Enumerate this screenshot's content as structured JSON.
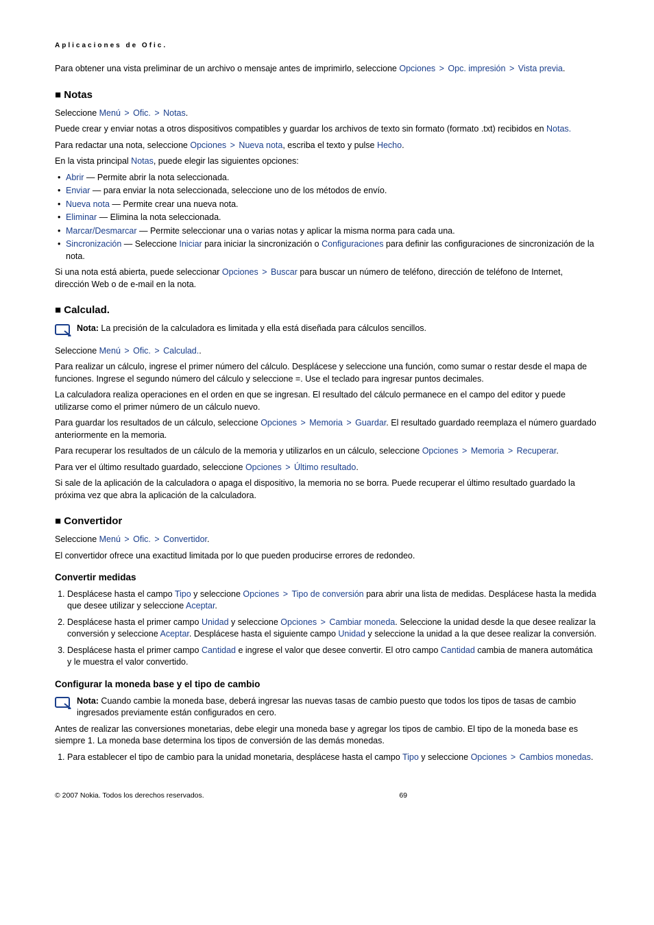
{
  "breadcrumb": "Aplicaciones de Ofic.",
  "intro": {
    "pre": "Para obtener una vista preliminar de un archivo o mensaje antes de imprimirlo, seleccione ",
    "opciones": "Opciones",
    "opc_imp": "Opc. impresión",
    "vista_previa": "Vista previa",
    "period": "."
  },
  "notas": {
    "heading": "Notas",
    "sel_pre": "Seleccione ",
    "menu": "Menú",
    "ofic": "Ofic.",
    "notas": "Notas",
    "period": ".",
    "p2a": "Puede crear y enviar notas a otros dispositivos compatibles y guardar los archivos de texto sin formato (formato .txt) recibidos en ",
    "p2b": "Notas.",
    "p3a": "Para redactar una nota, seleccione ",
    "p3_opc": "Opciones",
    "p3_nueva": "Nueva nota",
    "p3b": ", escriba el texto y pulse ",
    "p3_hecho": "Hecho",
    "p4a": "En la vista principal ",
    "p4_notas": "Notas",
    "p4b": ", puede elegir las siguientes opciones:",
    "items": [
      {
        "k": "Abrir",
        "t": " — Permite abrir la nota seleccionada."
      },
      {
        "k": "Enviar",
        "t": " — para enviar la nota seleccionada, seleccione uno de los métodos de envío."
      },
      {
        "k": "Nueva nota",
        "t": " — Permite crear una nueva nota."
      },
      {
        "k": "Eliminar",
        "t": " — Elimina la nota seleccionada."
      },
      {
        "k": "Marcar/Desmarcar",
        "t": " — Permite seleccionar una o varias notas y aplicar la misma norma para cada una."
      }
    ],
    "sync_k": "Sincronización",
    "sync_a": " — Seleccione ",
    "sync_iniciar": "Iniciar",
    "sync_b": " para iniciar la sincronización o ",
    "sync_conf": "Configuraciones",
    "sync_c": " para definir las configuraciones de sincronización de la nota.",
    "p5a": "Si una nota está abierta, puede seleccionar ",
    "p5_opc": "Opciones",
    "p5_buscar": "Buscar",
    "p5b": " para buscar un número de teléfono, dirección de teléfono de Internet, dirección Web o de e-mail en la nota."
  },
  "calc": {
    "heading": "Calculad.",
    "note_label": "Nota:",
    "note_text": "  La precisión de la calculadora es limitada y ella está diseñada para cálculos sencillos.",
    "sel_pre": "Seleccione ",
    "menu": "Menú",
    "ofic": "Ofic.",
    "calculad": "Calculad.",
    "period": ".",
    "p1": "Para realizar un cálculo, ingrese el primer número del cálculo. Desplácese y seleccione una función, como sumar o restar desde el mapa de funciones. Ingrese el segundo número del cálculo y seleccione =. Use el teclado para ingresar puntos decimales.",
    "p2": "La calculadora realiza operaciones en el orden en que se ingresan. El resultado del cálculo permanece en el campo del editor y puede utilizarse como el primer número de un cálculo nuevo.",
    "p3a": "Para guardar los resultados de un cálculo, seleccione ",
    "p3_opc": "Opciones",
    "p3_mem": "Memoria",
    "p3_guardar": "Guardar",
    "p3b": ". El resultado guardado reemplaza el número guardado anteriormente en la memoria.",
    "p4a": "Para recuperar los resultados de un cálculo de la memoria y utilizarlos en un cálculo, seleccione ",
    "p4_opc": "Opciones",
    "p4_mem": "Memoria",
    "p4_rec": "Recuperar",
    "p5a": "Para ver el último resultado guardado, seleccione ",
    "p5_opc": "Opciones",
    "p5_ult": "Último resultado",
    "p6": "Si sale de la aplicación de la calculadora o apaga el dispositivo, la memoria no se borra. Puede recuperar el último resultado guardado la próxima vez que abra la aplicación de la calculadora."
  },
  "conv": {
    "heading": "Convertidor",
    "sel_pre": "Seleccione ",
    "menu": "Menú",
    "ofic": "Ofic.",
    "convertidor": "Convertidor",
    "period": ".",
    "p1": "El convertidor ofrece una exactitud limitada por lo que pueden producirse errores de redondeo.",
    "h3a": "Convertir medidas",
    "s1a": "Desplácese hasta el campo ",
    "tipo": "Tipo",
    "s1b": " y seleccione ",
    "s1_opc": "Opciones",
    "s1_tipoconv": "Tipo de conversión",
    "s1c": " para abrir una lista de medidas. Desplácese hasta la medida que desee utilizar y seleccione ",
    "s1_aceptar": "Aceptar",
    "s2a": "Desplácese hasta el primer campo ",
    "unidad": "Unidad",
    "s2b": " y seleccione ",
    "s2_opc": "Opciones",
    "s2_cambmon": "Cambiar moneda",
    "s2c": ". Seleccione la unidad desde la que desee realizar la conversión y seleccione ",
    "s2_aceptar": "Aceptar",
    "s2d": ". Desplácese hasta el siguiente campo ",
    "s2_unidad2": "Unidad",
    "s2e": " y seleccione la unidad a la que desee realizar la conversión.",
    "s3a": "Desplácese hasta el primer campo ",
    "cantidad": "Cantidad",
    "s3b": " e ingrese el valor que desee convertir. El otro campo ",
    "s3_cantidad2": "Cantidad",
    "s3c": " cambia de manera automática y le muestra el valor convertido.",
    "h3b": "Configurar la moneda base y el tipo de cambio",
    "note_label": "Nota:",
    "note_text": "  Cuando cambie la moneda base, deberá ingresar las nuevas tasas de cambio puesto que todos los tipos de tasas de cambio ingresados previamente están configurados en cero.",
    "p2": "Antes de realizar las conversiones monetarias, debe elegir una moneda base y agregar los tipos de cambio. El tipo de la moneda base es siempre 1. La moneda base determina los tipos de conversión de las demás monedas.",
    "s4a": "Para establecer el tipo de cambio para la unidad monetaria, desplácese hasta el campo ",
    "s4_tipo": "Tipo",
    "s4b": " y seleccione ",
    "s4_opc": "Opciones",
    "s4_camb": "Cambios monedas"
  },
  "footer": {
    "copyright": "© 2007 Nokia. Todos los derechos reservados.",
    "page": "69"
  }
}
